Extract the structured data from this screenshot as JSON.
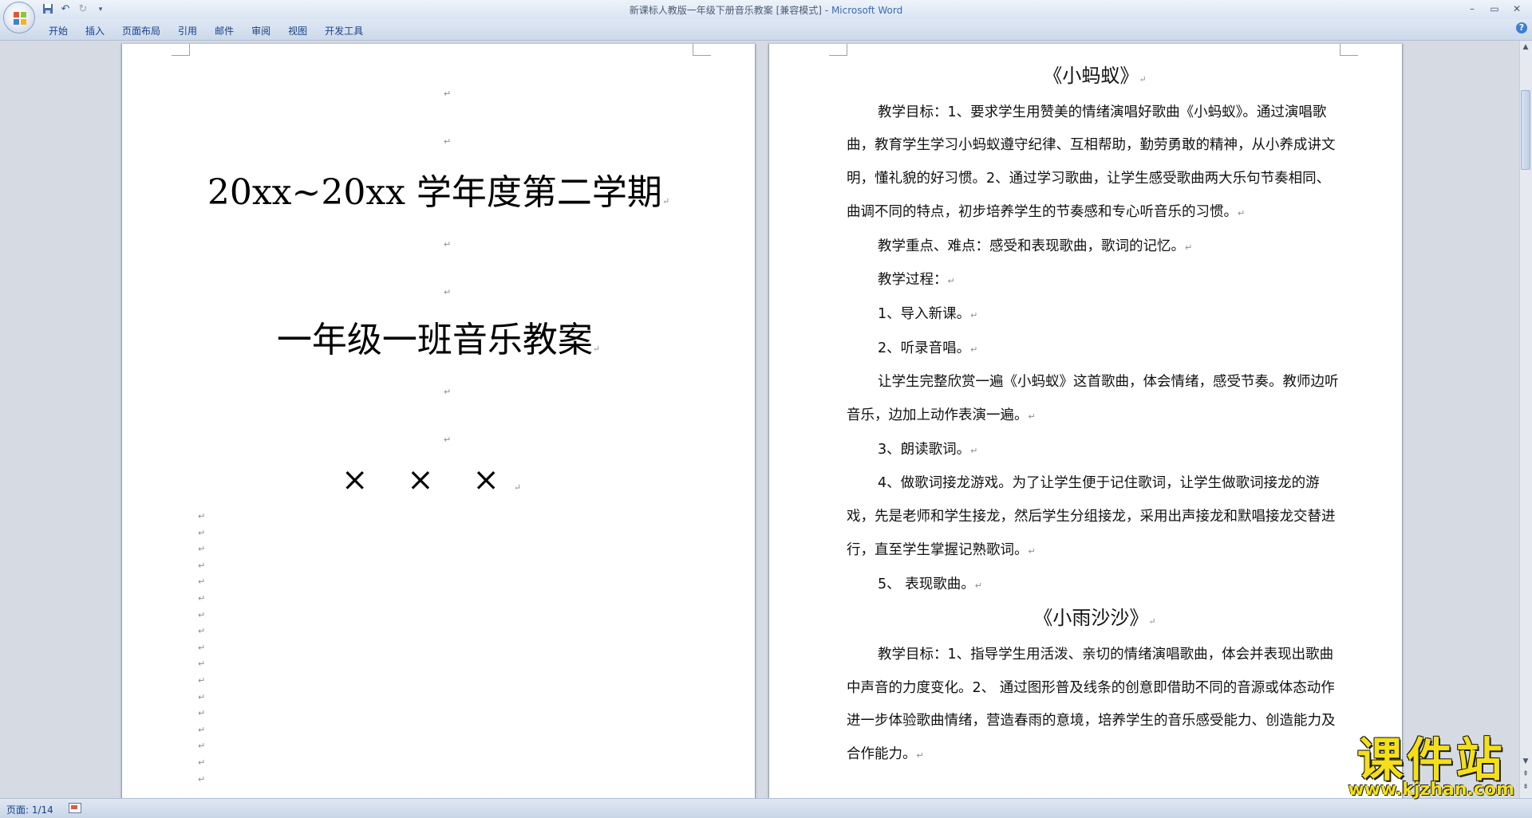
{
  "window": {
    "doc_title": "新课标人教版一年级下册音乐教案 [兼容模式]",
    "title_sep": " - ",
    "app_name": "Microsoft Word"
  },
  "ribbon": {
    "tabs": [
      "开始",
      "插入",
      "页面布局",
      "引用",
      "邮件",
      "审阅",
      "视图",
      "开发工具"
    ]
  },
  "page1": {
    "term": "20xx~20xx 学年度第二学期",
    "class_title": "一年级一班音乐教案",
    "author": "× × ×",
    "paragraph_mark": "↵"
  },
  "page2": {
    "heading1": "《小蚂蚁》",
    "p1": "教学目标：1、要求学生用赞美的情绪演唱好歌曲《小蚂蚁》。通过演唱歌曲，教育学生学习小蚂蚁遵守纪律、互相帮助，勤劳勇敢的精神，从小养成讲文明，懂礼貌的好习惯。2、通过学习歌曲，让学生感受歌曲两大乐句节奏相同、曲调不同的特点，初步培养学生的节奏感和专心听音乐的习惯。",
    "p2": "教学重点、难点：感受和表现歌曲，歌词的记忆。",
    "p3": "教学过程：",
    "p4": "1、导入新课。",
    "p5": "2、听录音唱。",
    "p6": "让学生完整欣赏一遍《小蚂蚁》这首歌曲，体会情绪，感受节奏。教师边听音乐，边加上动作表演一遍。",
    "p7": "3、朗读歌词。",
    "p8": "4、做歌词接龙游戏。为了让学生便于记住歌词，让学生做歌词接龙的游戏，先是老师和学生接龙，然后学生分组接龙，采用出声接龙和默唱接龙交替进行，直至学生掌握记熟歌词。",
    "p9": "5、 表现歌曲。",
    "heading2": "《小雨沙沙》",
    "p10": "教学目标：1、指导学生用活泼、亲切的情绪演唱歌曲，体会并表现出歌曲中声音的力度变化。2、 通过图形普及线条的创意即借助不同的音源或体态动作进一步体验歌曲情绪，营造春雨的意境，培养学生的音乐感受能力、创造能力及合作能力。"
  },
  "statusbar": {
    "page_info": "页面: 1/14"
  },
  "watermark": {
    "big": "课件站",
    "small": "www.kjzhan.com"
  },
  "colors": {
    "accent": "#15428b",
    "watermark": "#f5e017"
  }
}
